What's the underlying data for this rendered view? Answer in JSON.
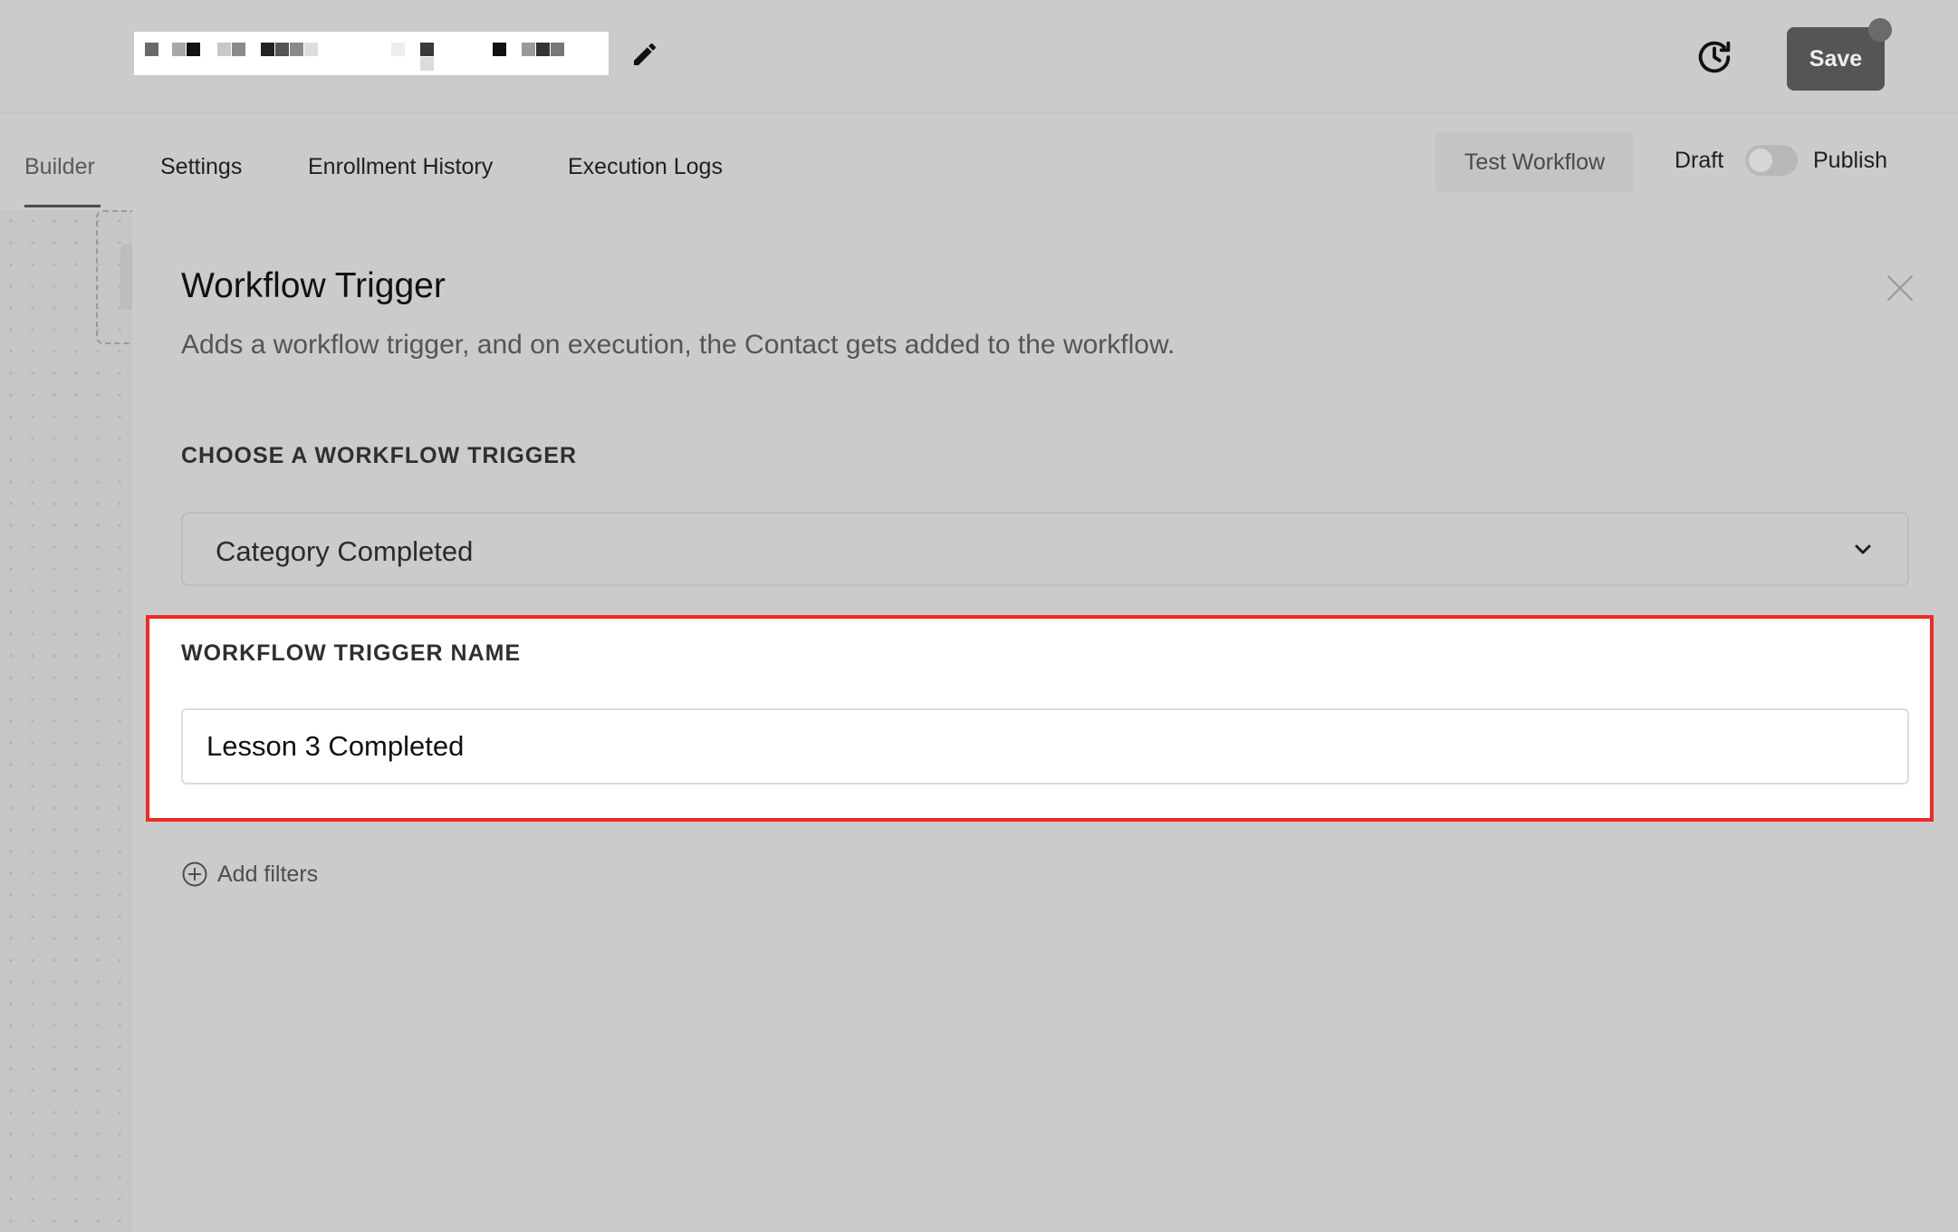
{
  "header": {
    "workflow_name": "",
    "save_label": "Save"
  },
  "tabs": [
    {
      "label": "Builder",
      "active": true
    },
    {
      "label": "Settings",
      "active": false
    },
    {
      "label": "Enrollment History",
      "active": false
    },
    {
      "label": "Execution Logs",
      "active": false
    }
  ],
  "actions": {
    "test_workflow_label": "Test Workflow",
    "draft_label": "Draft",
    "publish_label": "Publish",
    "published": false
  },
  "panel": {
    "title": "Workflow Trigger",
    "description": "Adds a workflow trigger, and on execution, the Contact gets added to the workflow.",
    "trigger_section_label": "CHOOSE A WORKFLOW TRIGGER",
    "trigger_value": "Category Completed",
    "name_section_label": "WORKFLOW TRIGGER NAME",
    "name_value": "Lesson 3 Completed",
    "add_filters_label": "Add filters"
  },
  "icons": {
    "edit": "pencil-icon",
    "history": "history-icon",
    "close": "close-icon",
    "dropdown": "chevron-down-icon",
    "add": "plus-circle-icon"
  },
  "colors": {
    "highlight": "#ee2a24",
    "save_button": "#555555"
  }
}
